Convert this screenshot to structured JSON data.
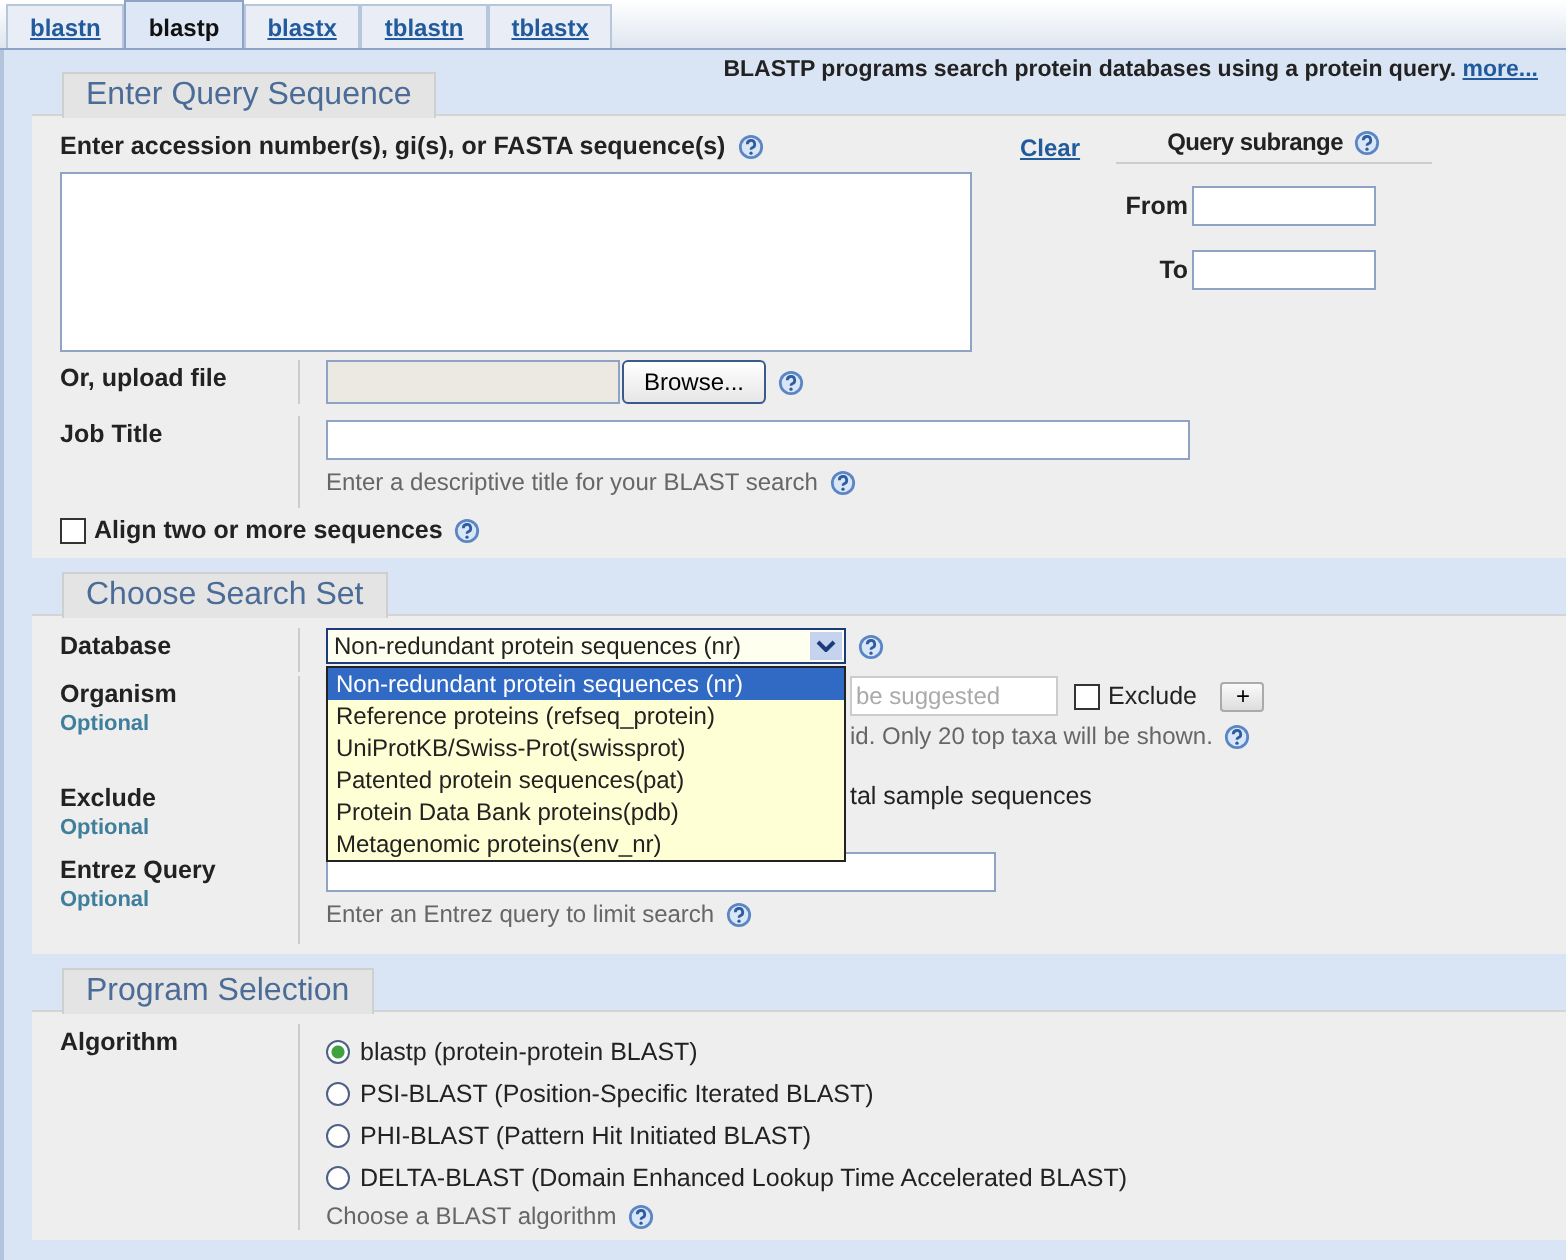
{
  "tabs": [
    {
      "label": "blastn",
      "selected": false
    },
    {
      "label": "blastp",
      "selected": true
    },
    {
      "label": "blastx",
      "selected": false
    },
    {
      "label": "tblastn",
      "selected": false
    },
    {
      "label": "tblastx",
      "selected": false
    }
  ],
  "intro": {
    "text": "BLASTP programs search protein databases using a protein query.",
    "link": "more..."
  },
  "query_section": {
    "title": "Enter Query Sequence",
    "sequence_label": "Enter accession number(s), gi(s), or FASTA sequence(s)",
    "clear_link": "Clear",
    "subrange_label": "Query subrange",
    "from_label": "From",
    "to_label": "To",
    "upload_label": "Or, upload file",
    "browse_button": "Browse...",
    "job_title_label": "Job Title",
    "job_title_hint": "Enter a descriptive title for your BLAST search",
    "align_label": "Align two or more sequences",
    "align_checked": false
  },
  "search_set": {
    "title": "Choose Search Set",
    "database_label": "Database",
    "database_value": "Non-redundant protein sequences (nr)",
    "database_expanded": true,
    "database_options": [
      {
        "label": "Non-redundant protein sequences (nr)",
        "selected": true
      },
      {
        "label": "Reference proteins (refseq_protein)",
        "selected": false
      },
      {
        "label": "UniProtKB/Swiss-Prot(swissprot)",
        "selected": false
      },
      {
        "label": "Patented protein sequences(pat)",
        "selected": false
      },
      {
        "label": "Protein Data Bank proteins(pdb)",
        "selected": false
      },
      {
        "label": "Metagenomic proteins(env_nr)",
        "selected": false
      }
    ],
    "organism_label": "Organism",
    "organism_optional": "Optional",
    "organism_placeholder": "be suggested",
    "organism_exclude_label": "Exclude",
    "organism_exclude_checked": false,
    "add_button": "+",
    "organism_hint": "id. Only 20 top taxa will be shown.",
    "exclude_label": "Exclude",
    "exclude_optional": "Optional",
    "exclude_text": "tal sample sequences",
    "entrez_label": "Entrez Query",
    "entrez_optional": "Optional",
    "entrez_hint": "Enter an Entrez query to limit search"
  },
  "program": {
    "title": "Program Selection",
    "algorithm_label": "Algorithm",
    "algorithms": [
      {
        "label": "blastp (protein-protein BLAST)",
        "selected": true
      },
      {
        "label": "PSI-BLAST (Position-Specific Iterated BLAST)",
        "selected": false
      },
      {
        "label": "PHI-BLAST (Pattern Hit Initiated BLAST)",
        "selected": false
      },
      {
        "label": "DELTA-BLAST (Domain Enhanced Lookup Time Accelerated BLAST)",
        "selected": false
      }
    ],
    "hint": "Choose a BLAST algorithm"
  }
}
